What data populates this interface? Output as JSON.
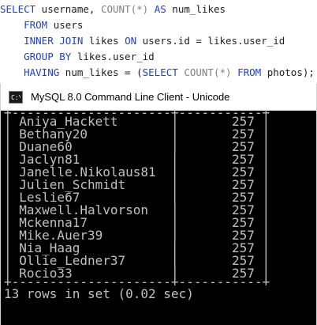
{
  "sql": {
    "line1": [
      "SELECT",
      " username, ",
      "COUNT(*)",
      " ",
      "AS",
      " num_likes"
    ],
    "line2": [
      "FROM",
      " users"
    ],
    "line3": [
      "INNER JOIN",
      " likes ",
      "ON",
      " users.id = likes.user_id"
    ],
    "line4": [
      "GROUP BY",
      " likes.user_id"
    ],
    "line5": [
      "HAVING",
      " num_likes = (",
      "SELECT",
      " ",
      "COUNT(*)",
      " ",
      "FROM",
      " photos);"
    ]
  },
  "window": {
    "title": "MySQL 8.0 Command Line Client - Unicode"
  },
  "console": {
    "separator": "+---------------------+-----------+",
    "rows": [
      {
        "username": "Aniya_Hackett",
        "num_likes": "257"
      },
      {
        "username": "Bethany20",
        "num_likes": "257"
      },
      {
        "username": "Duane60",
        "num_likes": "257"
      },
      {
        "username": "Jaclyn81",
        "num_likes": "257"
      },
      {
        "username": "Janelle.Nikolaus81",
        "num_likes": "257"
      },
      {
        "username": "Julien_Schmidt",
        "num_likes": "257"
      },
      {
        "username": "Leslie67",
        "num_likes": "257"
      },
      {
        "username": "Maxwell.Halvorson",
        "num_likes": "257"
      },
      {
        "username": "Mckenna17",
        "num_likes": "257"
      },
      {
        "username": "Mike.Auer39",
        "num_likes": "257"
      },
      {
        "username": "Nia_Haag",
        "num_likes": "257"
      },
      {
        "username": "Ollie_Ledner37",
        "num_likes": "257"
      },
      {
        "username": "Rocio33",
        "num_likes": "257"
      }
    ],
    "summary": "13 rows in set (0.02 sec)"
  },
  "colors": {
    "keyword": "#1c3fd8",
    "function": "#808080",
    "console_bg": "#000000",
    "console_text": "#c0c0c0"
  },
  "icons": {
    "app": "console-icon"
  }
}
